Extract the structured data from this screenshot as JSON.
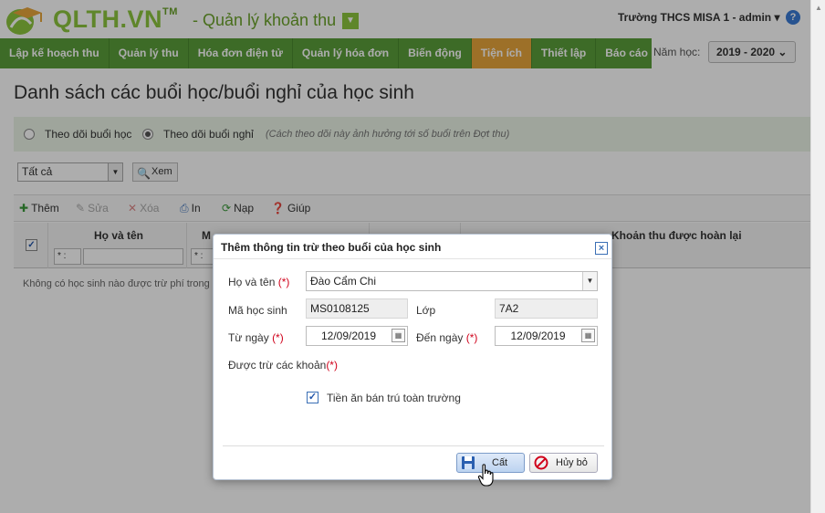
{
  "header": {
    "brand": "QLTH.VN",
    "brand_tm": "TM",
    "subtitle": "- Quản lý khoản thu",
    "school_user": "Trường THCS MISA 1 - admin ▾",
    "help_icon": "question-circle-icon"
  },
  "nav": {
    "items": [
      {
        "label": "Lập kế hoạch thu"
      },
      {
        "label": "Quản lý thu"
      },
      {
        "label": "Hóa đơn điện tử"
      },
      {
        "label": "Quản lý hóa đơn"
      },
      {
        "label": "Biến động"
      },
      {
        "label": "Tiện ích",
        "active": true
      },
      {
        "label": "Thiết lập"
      },
      {
        "label": "Báo cáo"
      }
    ],
    "active_color": "#e8a53c",
    "bar_color": "#5a9e3a",
    "year_label": "Năm học:",
    "year_value": "2019 - 2020 ⌄"
  },
  "page": {
    "title": "Danh sách các buổi học/buổi nghỉ của học sinh",
    "option_study": "Theo dõi buổi học",
    "option_absent": "Theo dõi buổi nghỉ",
    "option_note": "(Cách theo dõi này ảnh hưởng tới số buổi trên Đợt thu)",
    "filter_value": "Tất cả",
    "view_button": "Xem",
    "toolbar": {
      "add": "Thêm",
      "edit": "Sửa",
      "delete": "Xóa",
      "print": "In",
      "load": "Nạp",
      "help": "Giúp"
    },
    "grid": {
      "col_name": "Họ và tên",
      "col_code": "M",
      "col_refund": "Khoản thu được hoàn lại",
      "filter_op": "* :",
      "empty_message": "Không có học sinh nào được trừ phí trong"
    }
  },
  "dialog": {
    "title": "Thêm thông tin trừ theo buổi của học sinh",
    "label_name": "Họ và tên",
    "required_mark": "(*)",
    "value_name": "Đào Cẩm Chi",
    "label_student_code": "Mã học sinh",
    "value_student_code": "MS0108125",
    "label_class": "Lớp",
    "value_class": "7A2",
    "label_from": "Từ ngày",
    "value_from": "12/09/2019",
    "label_to": "Đến ngày",
    "value_to": "12/09/2019",
    "label_items": "Được trừ các khoản",
    "item_1": "Tiền ăn bán trú toàn trường",
    "item_1_checked": true,
    "save_button": "Cất",
    "cancel_button": "Hủy bỏ"
  }
}
